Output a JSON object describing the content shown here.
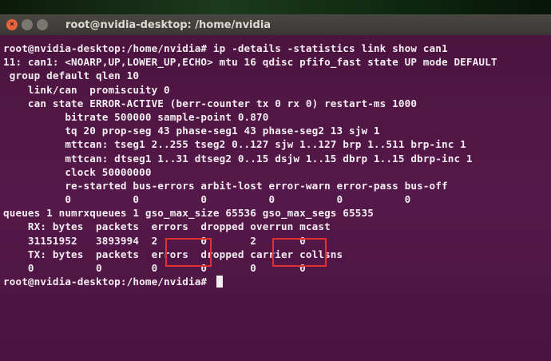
{
  "window": {
    "title": "root@nvidia-desktop: /home/nvidia"
  },
  "terminal": {
    "lines": [
      "root@nvidia-desktop:/home/nvidia# ip -details -statistics link show can1",
      "11: can1: <NOARP,UP,LOWER_UP,ECHO> mtu 16 qdisc pfifo_fast state UP mode DEFAULT",
      " group default qlen 10",
      "    link/can  promiscuity 0",
      "    can state ERROR-ACTIVE (berr-counter tx 0 rx 0) restart-ms 1000",
      "          bitrate 500000 sample-point 0.870",
      "          tq 20 prop-seg 43 phase-seg1 43 phase-seg2 13 sjw 1",
      "          mttcan: tseg1 2..255 tseg2 0..127 sjw 1..127 brp 1..511 brp-inc 1",
      "          mttcan: dtseg1 1..31 dtseg2 0..15 dsjw 1..15 dbrp 1..15 dbrp-inc 1",
      "          clock 50000000",
      "          re-started bus-errors arbit-lost error-warn error-pass bus-off",
      "          0          0          0          0          0          0",
      "queues 1 numrxqueues 1 gso_max_size 65536 gso_max_segs 65535",
      "    RX: bytes  packets  errors  dropped overrun mcast",
      "    31151952   3893994  2       0       2       0",
      "    TX: bytes  packets  errors  dropped carrier collsns",
      "    0          0        0       0       0       0",
      "root@nvidia-desktop:/home/nvidia# "
    ]
  }
}
